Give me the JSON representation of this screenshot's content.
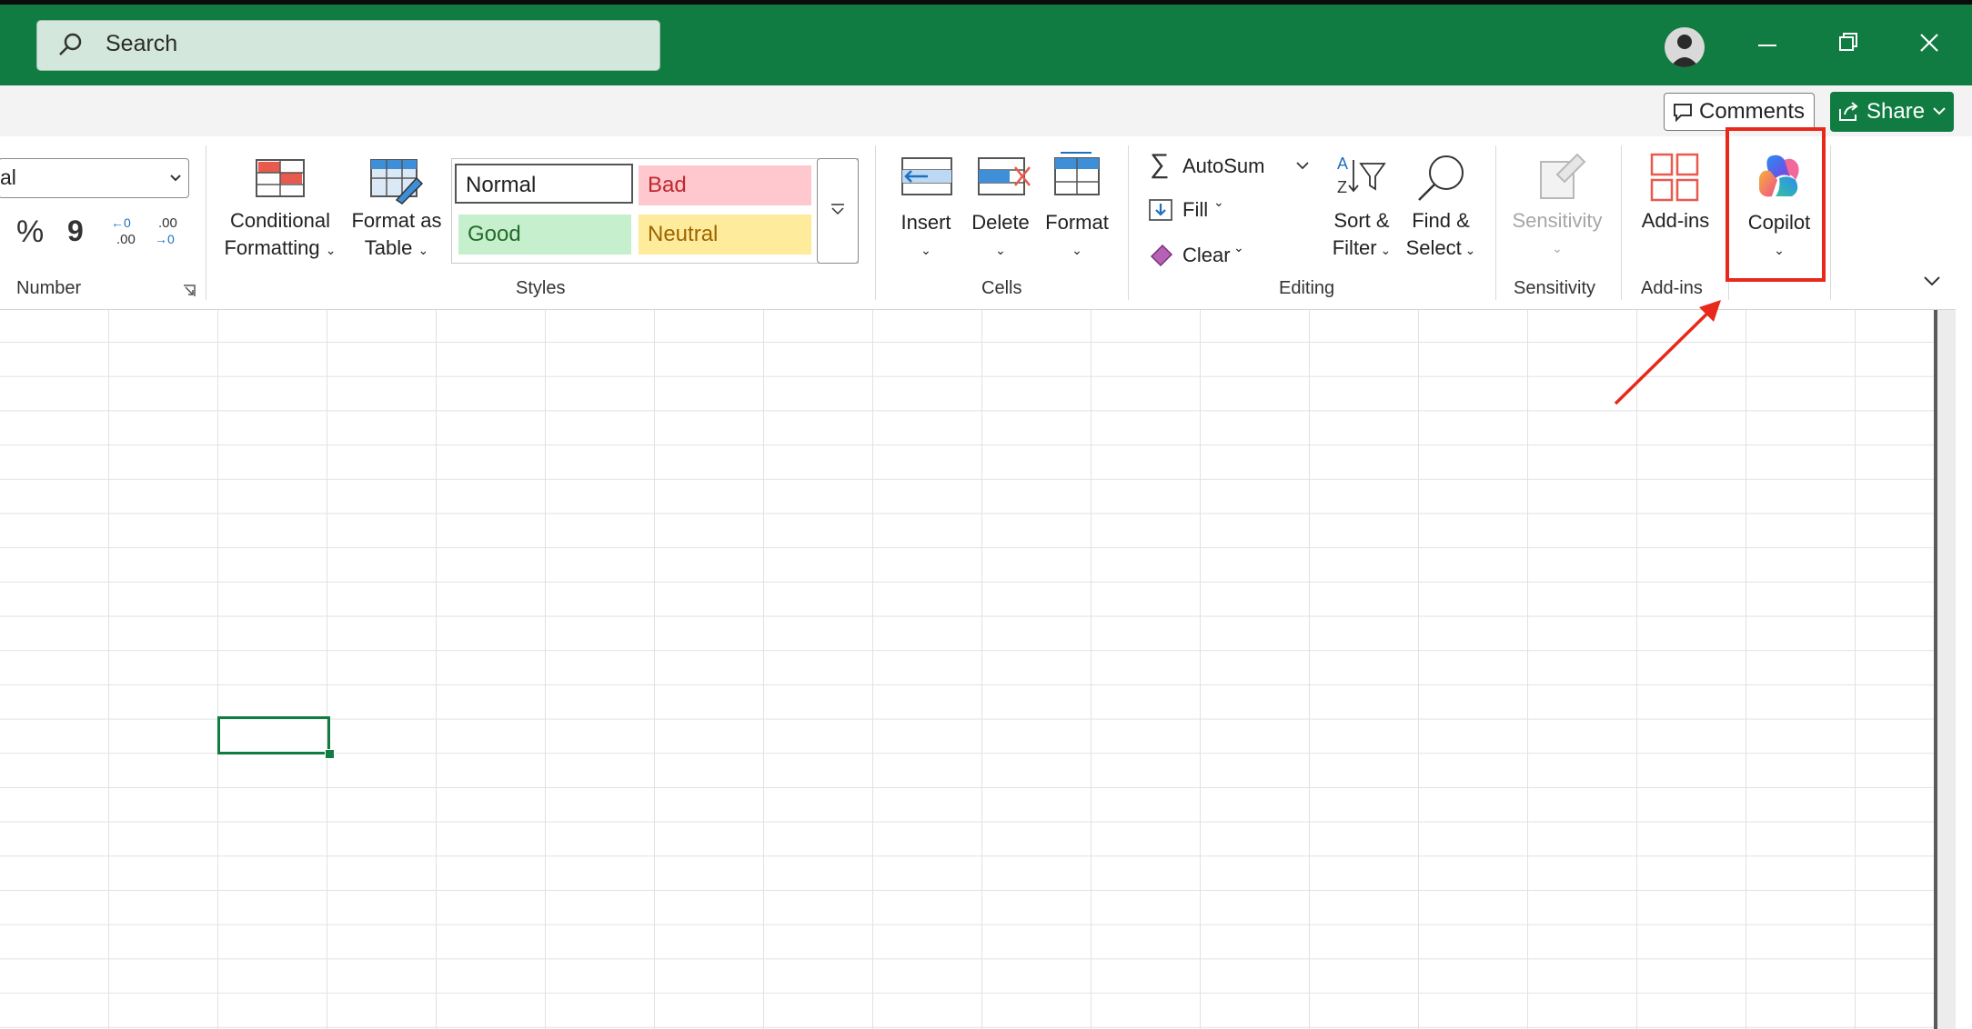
{
  "titlebar": {
    "search_placeholder": "Search",
    "controls": [
      "minimize-icon",
      "restore-icon",
      "close-icon"
    ]
  },
  "commands": {
    "comments_label": "Comments",
    "share_label": "Share"
  },
  "ribbon": {
    "number": {
      "format_value": "al",
      "percent_symbol": "%",
      "comma_symbol": "9",
      "group_label": "Number"
    },
    "styles": {
      "conditional_formatting": [
        "Conditional",
        "Formatting"
      ],
      "format_as_table": [
        "Format as",
        "Table"
      ],
      "gallery": [
        "Normal",
        "Bad",
        "Good",
        "Neutral"
      ],
      "group_label": "Styles"
    },
    "cells": {
      "insert": "Insert",
      "delete": "Delete",
      "format": "Format",
      "group_label": "Cells"
    },
    "editing": {
      "autosum": "AutoSum",
      "fill": "Fill",
      "clear": "Clear",
      "sort_filter": [
        "Sort &",
        "Filter"
      ],
      "find_select": [
        "Find &",
        "Select"
      ],
      "group_label": "Editing"
    },
    "sensitivity": {
      "button": "Sensitivity",
      "group_label": "Sensitivity"
    },
    "addins": {
      "button": "Add-ins",
      "group_label": "Add-ins"
    },
    "copilot": {
      "button": "Copilot"
    }
  },
  "colors": {
    "excel_green": "#107c41",
    "annotation_red": "#e8281a",
    "bad_fill": "#ffc7ce",
    "bad_text": "#c0272d",
    "good_fill": "#c6efce",
    "good_text": "#246b2a",
    "neutral_fill": "#ffeb9c",
    "neutral_text": "#9c6500"
  }
}
